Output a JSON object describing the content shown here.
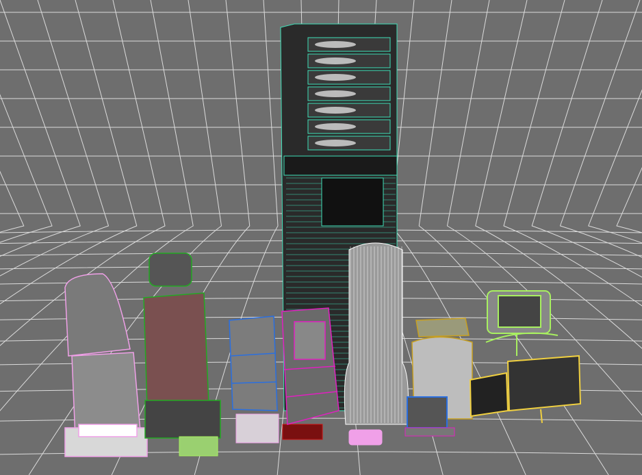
{
  "colors": {
    "background": "#6e6e6e",
    "grid": "#ffffff",
    "rack_wire": "#3fe0b8",
    "rack_body": "#2a2a2a",
    "cylinder": "#ffffff",
    "pink_chair": "#f0a0e8",
    "green_chair": "#22aa22",
    "chair_fill": "#7a5050",
    "blue_cabinet": "#2a6fe0",
    "magenta_cabinet": "#e020c0",
    "gold_machine": "#c8a020",
    "lime_monitor": "#a8f060",
    "yellow_monitor": "#f0d040",
    "red_box": "#cc1010"
  }
}
